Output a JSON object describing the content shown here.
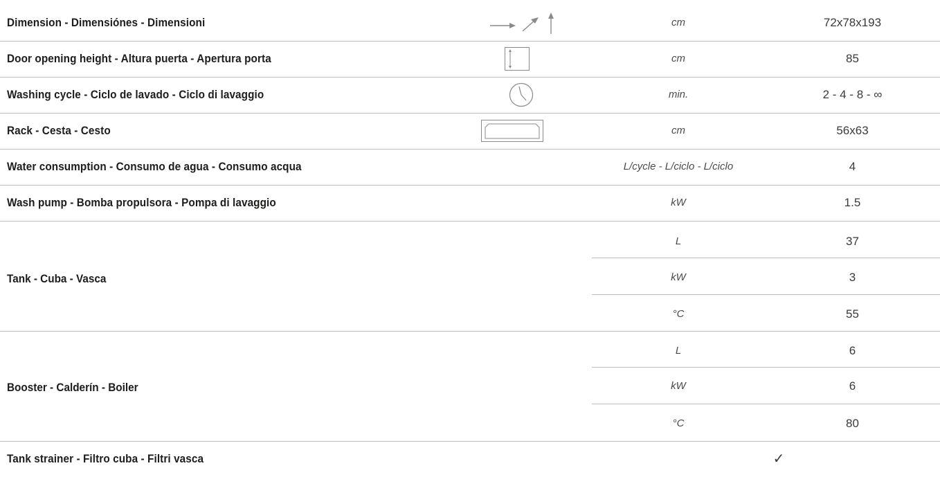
{
  "rows": [
    {
      "label": "Dimension - Dimensiónes - Dimensioni",
      "icon": "dimension-arrows-icon",
      "unit": "cm",
      "value": "72x78x193"
    },
    {
      "label": "Door opening height - Altura puerta - Apertura porta",
      "icon": "door-height-icon",
      "unit": "cm",
      "value": "85"
    },
    {
      "label": "Washing cycle - Ciclo de lavado - Ciclo di lavaggio",
      "icon": "clock-icon",
      "unit": "min.",
      "value": "2 - 4 - 8 - ∞"
    },
    {
      "label": "Rack - Cesta - Cesto",
      "icon": "rack-icon",
      "unit": "cm",
      "value": "56x63"
    },
    {
      "label": "Water consumption - Consumo de agua - Consumo acqua",
      "unit": "L/cycle - L/ciclo - L/ciclo",
      "value": "4"
    },
    {
      "label": "Wash pump - Bomba propulsora - Pompa di lavaggio",
      "unit": "kW",
      "value": "1.5"
    }
  ],
  "tank": {
    "label": "Tank - Cuba - Vasca",
    "sub": [
      {
        "unit": "L",
        "value": "37"
      },
      {
        "unit": "kW",
        "value": "3"
      },
      {
        "unit": "°C",
        "value": "55"
      }
    ]
  },
  "booster": {
    "label": "Booster - Calderín - Boiler",
    "sub": [
      {
        "unit": "L",
        "value": "6"
      },
      {
        "unit": "kW",
        "value": "6"
      },
      {
        "unit": "°C",
        "value": "80"
      }
    ]
  },
  "strainer": {
    "label": "Tank strainer - Filtro cuba - Filtri vasca",
    "value_icon": "checkmark-icon",
    "check": "✓"
  },
  "colors": {
    "text": "#1d1d1b",
    "rule": "#bdbdbd",
    "icon": "#8a8a8a"
  }
}
